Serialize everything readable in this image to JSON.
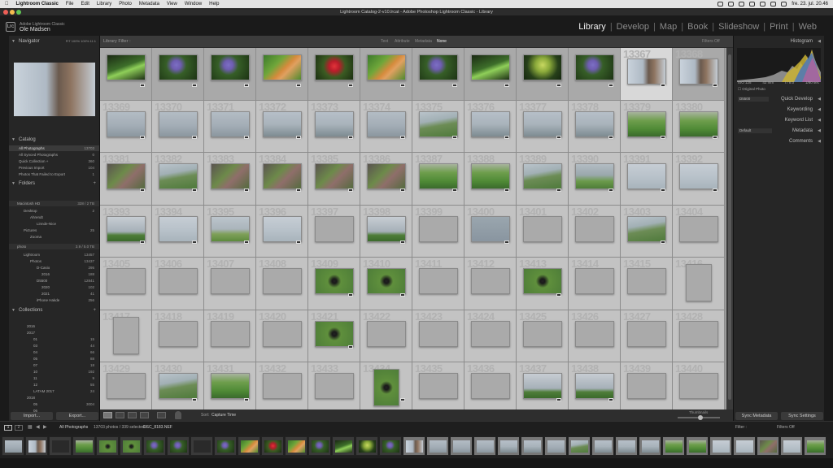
{
  "menubar": {
    "apple": "",
    "items": [
      "Lightroom Classic",
      "File",
      "Edit",
      "Library",
      "Photo",
      "Metadata",
      "View",
      "Window",
      "Help"
    ],
    "clock": "fre. 23. jul. 20.46"
  },
  "window": {
    "title": "Lightroom Catalog-2-v10.lrcat - Adobe Photoshop Lightroom Classic - Library"
  },
  "identity": {
    "line1": "Adobe Lightroom Classic",
    "line2": "Ole Madsen",
    "logo": "Lrc"
  },
  "modules": {
    "library": "Library",
    "develop": "Develop",
    "map": "Map",
    "book": "Book",
    "slideshow": "Slideshow",
    "print": "Print",
    "web": "Web",
    "sep": "|"
  },
  "navigator": {
    "title": "Navigator",
    "zoom": [
      "FIT",
      "100%",
      "100%",
      "11:1"
    ]
  },
  "catalog": {
    "title": "Catalog",
    "items": [
      {
        "label": "All Photographs",
        "count": "13703"
      },
      {
        "label": "All Synced Photographs",
        "count": "0"
      },
      {
        "label": "Quick Collection +",
        "count": "360"
      },
      {
        "label": "Previous Import",
        "count": "104"
      },
      {
        "label": "Photos That Failed to Export",
        "count": "1"
      }
    ]
  },
  "folders": {
    "title": "Folders",
    "vol1": {
      "name": "Macintosh HD",
      "size": "328 / 2 TB"
    },
    "vol1_items": [
      {
        "label": "Desktop",
        "count": "2"
      },
      {
        "label": "Ahrendt",
        "count": ""
      },
      {
        "label": "Linnde-Nice",
        "count": ""
      },
      {
        "label": "Pictures",
        "count": "25"
      },
      {
        "label": "Zooma",
        "count": ""
      }
    ],
    "vol2": {
      "name": "photo",
      "size": "3.9 / 5.0 TB"
    },
    "vol2_items": [
      {
        "label": "Lightroom",
        "count": "13457"
      },
      {
        "label": "Photos",
        "count": "13437"
      },
      {
        "label": "D-Casio",
        "count": "295"
      },
      {
        "label": "2016",
        "count": "188"
      },
      {
        "label": "D5500",
        "count": "12841"
      },
      {
        "label": "2020",
        "count": "102"
      },
      {
        "label": "2021",
        "count": "41"
      },
      {
        "label": "iPhone Hakde",
        "count": "256"
      }
    ]
  },
  "collections": {
    "title": "Collections",
    "items": [
      {
        "label": "2016",
        "count": ""
      },
      {
        "label": "2017",
        "count": ""
      },
      {
        "label": "01",
        "count": "15"
      },
      {
        "label": "03",
        "count": "44"
      },
      {
        "label": "04",
        "count": "66"
      },
      {
        "label": "05",
        "count": "88"
      },
      {
        "label": "07",
        "count": "18"
      },
      {
        "label": "10",
        "count": "192"
      },
      {
        "label": "11",
        "count": "9"
      },
      {
        "label": "12",
        "count": "55"
      },
      {
        "label": "LATAM 2017",
        "count": "24"
      },
      {
        "label": "2018",
        "count": ""
      },
      {
        "label": "05",
        "count": "3004"
      },
      {
        "label": "06",
        "count": ""
      }
    ]
  },
  "left_buttons": {
    "import": "Import...",
    "export": "Export..."
  },
  "filter": {
    "title": "Library Filter :",
    "text": "Text",
    "attribute": "Attribute",
    "metadata": "Metadata",
    "none": "None",
    "filters_off": "Filters Off"
  },
  "grid": {
    "rows": [
      {
        "nums": [
          "",
          "",
          "",
          "",
          "",
          "",
          "",
          "",
          "",
          "",
          "13367",
          "13368"
        ],
        "img": [
          "flower",
          "thistle",
          "thistle",
          "cat",
          "red",
          "cat",
          "thistle",
          "flower",
          "dill",
          "thistle",
          "person",
          "person"
        ]
      },
      {
        "nums": [
          "13369",
          "13370",
          "13371",
          "13372",
          "13373",
          "13374",
          "13375",
          "13376",
          "13377",
          "13378",
          "13379",
          "13380"
        ],
        "img": [
          "fog",
          "fog",
          "fog",
          "fogsea",
          "fogsea",
          "fog",
          "cliff",
          "fogsea",
          "fogsea",
          "fogsea",
          "green",
          "green"
        ]
      },
      {
        "nums": [
          "13381",
          "13382",
          "13383",
          "13384",
          "13385",
          "13386",
          "13387",
          "13388",
          "13389",
          "13390",
          "13391",
          "13392"
        ],
        "img": [
          "rock",
          "cliff",
          "rock",
          "rock",
          "rock",
          "rock",
          "green",
          "green",
          "cliff",
          "house",
          "bird",
          "bird"
        ]
      },
      {
        "nums": [
          "13393",
          "13394",
          "13395",
          "13396",
          "13397",
          "13398",
          "13399",
          "13400",
          "13401",
          "13402",
          "13403",
          "13404"
        ],
        "img": [
          "puf2",
          "bird",
          "people",
          "bird",
          "grey",
          "puf2",
          "grey",
          "sea",
          "grey",
          "grey",
          "cliff",
          "grey"
        ]
      },
      {
        "nums": [
          "13405",
          "13406",
          "13407",
          "13408",
          "13409",
          "13410",
          "13411",
          "13412",
          "13413",
          "13414",
          "13415",
          "13416"
        ],
        "img": [
          "grey",
          "grey",
          "grey",
          "grey",
          "puffin",
          "puffin",
          "grey",
          "grey",
          "puffin",
          "grey",
          "grey",
          "greyv"
        ]
      },
      {
        "nums": [
          "13417",
          "13418",
          "13419",
          "13420",
          "13421",
          "13422",
          "13423",
          "13424",
          "13425",
          "13426",
          "13427",
          "13428"
        ],
        "img": [
          "greyv",
          "grey",
          "grey",
          "grey",
          "puffin",
          "grey",
          "grey",
          "grey",
          "grey",
          "grey",
          "grey",
          "grey"
        ]
      },
      {
        "nums": [
          "13429",
          "13430",
          "13431",
          "13432",
          "13433",
          "13434",
          "13435",
          "13436",
          "13437",
          "13438",
          "13439",
          "13440"
        ],
        "img": [
          "grey",
          "cliff",
          "green",
          "grey",
          "grey",
          "puffinv",
          "grey",
          "grey",
          "puf2",
          "puf2",
          "grey",
          "grey"
        ]
      }
    ]
  },
  "toolbar": {
    "sort_label": "Sort:",
    "sort_value": "Capture Time",
    "thumbnails": "Thumbnails"
  },
  "histogram": {
    "title": "Histogram",
    "iso": "ISO 125",
    "focal": "42 mm",
    "aperture": "f / 8.0",
    "shutter": "1/80 sec",
    "original": "Original Photo"
  },
  "right_sections": [
    {
      "label": "Quick Develop",
      "preset": "D5500"
    },
    {
      "label": "Keyword List",
      "preset": ""
    },
    {
      "label": "Metadata",
      "preset": "Default"
    },
    {
      "label": "Comments",
      "preset": ""
    }
  ],
  "keywording": "Keywording",
  "right_buttons": {
    "sync_metadata": "Sync Metadata",
    "sync_settings": "Sync Settings"
  },
  "filmstrip_bar": {
    "pages": [
      "1",
      "2"
    ],
    "source": "All Photographs",
    "count": "13703 photos / 339 selected /",
    "filename": "DSC_8183.NEF",
    "filter_label": "Filter :",
    "filter_value": "Filters Off"
  },
  "filmstrip": {
    "imgs": [
      "fog",
      "person",
      "dark",
      "green",
      "puffin",
      "puffin",
      "thistle",
      "thistle",
      "dark",
      "thistle",
      "cat",
      "red",
      "cat",
      "thistle",
      "flower",
      "dill",
      "thistle",
      "person",
      "fog",
      "fog",
      "fog",
      "fogsea",
      "fogsea",
      "fog",
      "cliff",
      "fogsea",
      "fogsea",
      "fogsea",
      "green",
      "green",
      "bird",
      "bird",
      "rock",
      "bird",
      "green"
    ],
    "selected_from": 17
  }
}
